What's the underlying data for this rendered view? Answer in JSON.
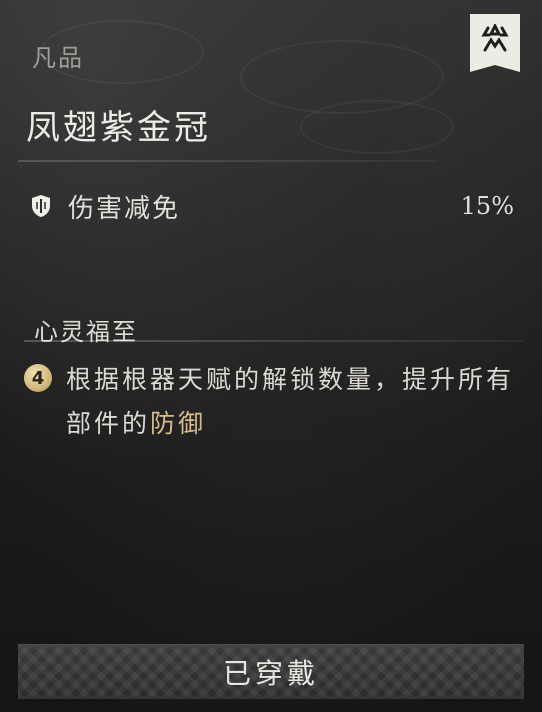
{
  "item": {
    "rarity": "凡品",
    "name": "凤翅紫金冠"
  },
  "stat": {
    "label": "伤害减免",
    "value": "15%",
    "icon": "shield-icon"
  },
  "set_bonus": {
    "name": "心灵福至",
    "pieces": "4",
    "text_main": "根据根器天赋的解锁数量，提升所有部件的",
    "text_highlight": "防御",
    "highlight_color": "#d6bc8a"
  },
  "equip_button": {
    "label": "已穿戴"
  },
  "badge": {
    "icon": "emblem-icon"
  }
}
